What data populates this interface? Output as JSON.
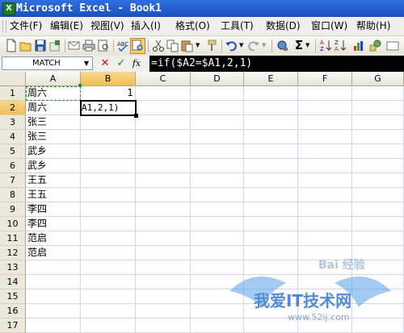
{
  "window": {
    "title": "Microsoft Excel - Book1",
    "app_icon": "excel-icon"
  },
  "menu": [
    {
      "label": "文件(F)",
      "name": "menu-file"
    },
    {
      "label": "编辑(E)",
      "name": "menu-edit"
    },
    {
      "label": "视图(V)",
      "name": "menu-view"
    },
    {
      "label": "插入(I)",
      "name": "menu-insert"
    },
    {
      "label": "格式(O)",
      "name": "menu-format"
    },
    {
      "label": "工具(T)",
      "name": "menu-tools"
    },
    {
      "label": "数据(D)",
      "name": "menu-data"
    },
    {
      "label": "窗口(W)",
      "name": "menu-window"
    },
    {
      "label": "帮助(H)",
      "name": "menu-help"
    }
  ],
  "toolbar": {
    "icons": [
      "new-icon",
      "open-icon",
      "save-icon",
      "permission-icon",
      "email-icon",
      "print-icon",
      "print-preview-icon",
      "spelling-icon",
      "research-icon",
      "cut-icon",
      "copy-icon",
      "paste-icon",
      "format-painter-icon",
      "undo-icon",
      "redo-icon",
      "hyperlink-icon",
      "autosum-icon",
      "sort-icon"
    ],
    "autosum_glyph": "Σ"
  },
  "formula_bar": {
    "name_box": "MATCH",
    "cancel_glyph": "✕",
    "enter_glyph": "✓",
    "fx_glyph": "fx",
    "formula": "=if($A2=$A1,2,1)"
  },
  "sheet": {
    "columns": [
      "A",
      "B",
      "C",
      "D",
      "E",
      "F",
      "G"
    ],
    "rows": [
      "1",
      "2",
      "3",
      "4",
      "5",
      "6",
      "7",
      "8",
      "9",
      "10",
      "11",
      "12",
      "13",
      "14",
      "15",
      "16",
      "17"
    ],
    "column_a": [
      "周六",
      "周六",
      "张三",
      "张三",
      "武乡",
      "武乡",
      "王五",
      "王五",
      "李四",
      "李四",
      "范启",
      "范启"
    ],
    "b1": "1",
    "b2_editing": "A1,2,1)"
  },
  "watermark": {
    "text": "我爱IT技术网",
    "url": "www.52ij.com",
    "baidu": "Bai 经验"
  },
  "colors": {
    "title_bar": "#1c4fbf",
    "formula_input_bg": "#000000",
    "selection_header": "#f0be55",
    "ref_border": "#2e8b2e"
  }
}
